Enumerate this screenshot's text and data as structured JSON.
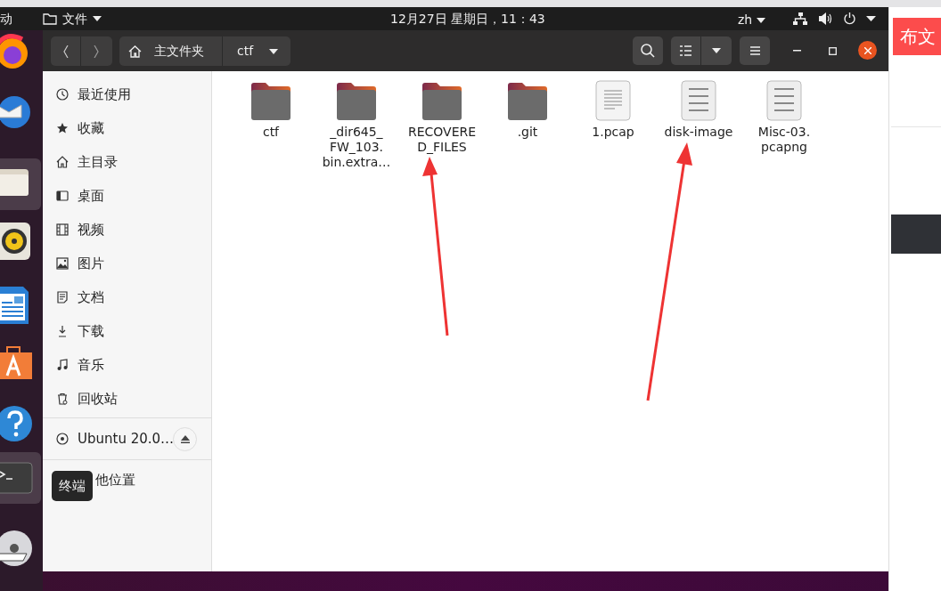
{
  "top_bar": {
    "activities": "动",
    "app_menu": "文件",
    "clock": "12月27日 星期日，11：43",
    "language": "zh"
  },
  "dock": [
    {
      "kind": "firefox",
      "selected": false
    },
    {
      "kind": "mail",
      "selected": false
    },
    {
      "kind": "files",
      "selected": true
    },
    {
      "kind": "speaker",
      "selected": false
    },
    {
      "kind": "writer",
      "selected": false
    },
    {
      "kind": "store",
      "selected": false
    },
    {
      "kind": "help",
      "selected": false
    },
    {
      "kind": "terminal",
      "selected": true
    },
    {
      "kind": "dvd",
      "selected": false
    }
  ],
  "tooltip": "终端",
  "window": {
    "path": [
      "主文件夹",
      "ctf"
    ]
  },
  "sidebar": {
    "items": [
      {
        "kind": "clock",
        "label": "最近使用"
      },
      {
        "kind": "star",
        "label": "收藏"
      },
      {
        "kind": "home",
        "label": "主目录"
      },
      {
        "kind": "desktop",
        "label": "桌面"
      },
      {
        "kind": "film",
        "label": "视频"
      },
      {
        "kind": "image",
        "label": "图片"
      },
      {
        "kind": "doc",
        "label": "文档"
      },
      {
        "kind": "download",
        "label": "下载"
      },
      {
        "kind": "music",
        "label": "音乐"
      },
      {
        "kind": "trash",
        "label": "回收站"
      }
    ],
    "devices": [
      {
        "label": "Ubuntu 20.0…"
      }
    ],
    "other": [
      {
        "label": "他位置"
      }
    ]
  },
  "files": [
    {
      "kind": "folder",
      "name": [
        "ctf"
      ]
    },
    {
      "kind": "folder",
      "name": [
        "_dir645_",
        "FW_103.",
        "bin.extra…"
      ]
    },
    {
      "kind": "folder",
      "name": [
        "RECOVERE",
        "D_FILES"
      ]
    },
    {
      "kind": "folder",
      "name": [
        ".git"
      ]
    },
    {
      "kind": "text",
      "name": [
        "1.pcap"
      ]
    },
    {
      "kind": "binary",
      "name": [
        "disk-image"
      ]
    },
    {
      "kind": "binary",
      "name": [
        "Misc-03.",
        "pcapng"
      ]
    }
  ],
  "background_page": {
    "button": "布文"
  }
}
